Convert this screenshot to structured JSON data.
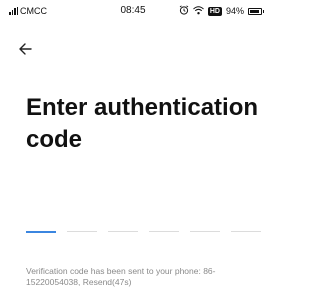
{
  "status_bar": {
    "carrier": "CMCC",
    "time": "08:45",
    "hd_badge": "HD",
    "battery": "94%",
    "battery_level": 0.94
  },
  "header": {
    "back_icon": "arrow-left-icon"
  },
  "title": "Enter authentication code",
  "code_input": {
    "length": 6,
    "active_index": 0
  },
  "info": {
    "message_prefix": "Verification code has been sent to your phone: 86-15220054038, ",
    "resend_label": "Resend(47s)"
  },
  "colors": {
    "accent": "#3b86e0",
    "muted_text": "#8a8a8a",
    "slot_inactive": "#dcdcdc"
  }
}
